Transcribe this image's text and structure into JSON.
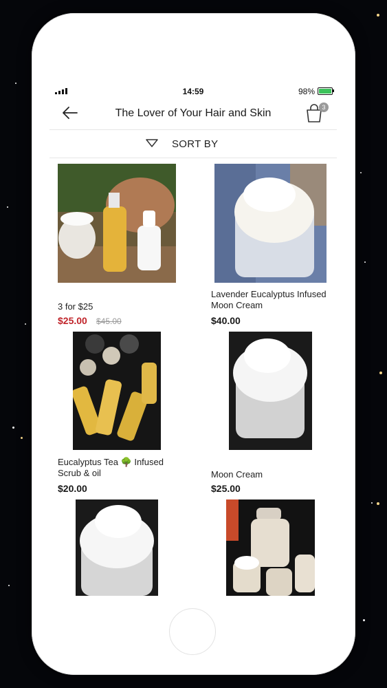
{
  "status_bar": {
    "time": "14:59",
    "battery": "98%"
  },
  "header": {
    "title": "The Lover of Your Hair and Skin",
    "cart_count": "3"
  },
  "sort": {
    "label": "SORT BY"
  },
  "products": [
    {
      "name": "3 for $25",
      "price": "$25.00",
      "old_price": "$45.00"
    },
    {
      "name": "Lavender Eucalyptus Infused Moon Cream",
      "price": "$40.00"
    },
    {
      "name": "Eucalyptus Tea 🌳 Infused Scrub & oil",
      "price": "$20.00"
    },
    {
      "name": "Moon Cream",
      "price": "$25.00"
    }
  ],
  "colors": {
    "sale_price": "#c0242a",
    "badge": "#9a9a9a",
    "battery": "#3cc35b"
  }
}
